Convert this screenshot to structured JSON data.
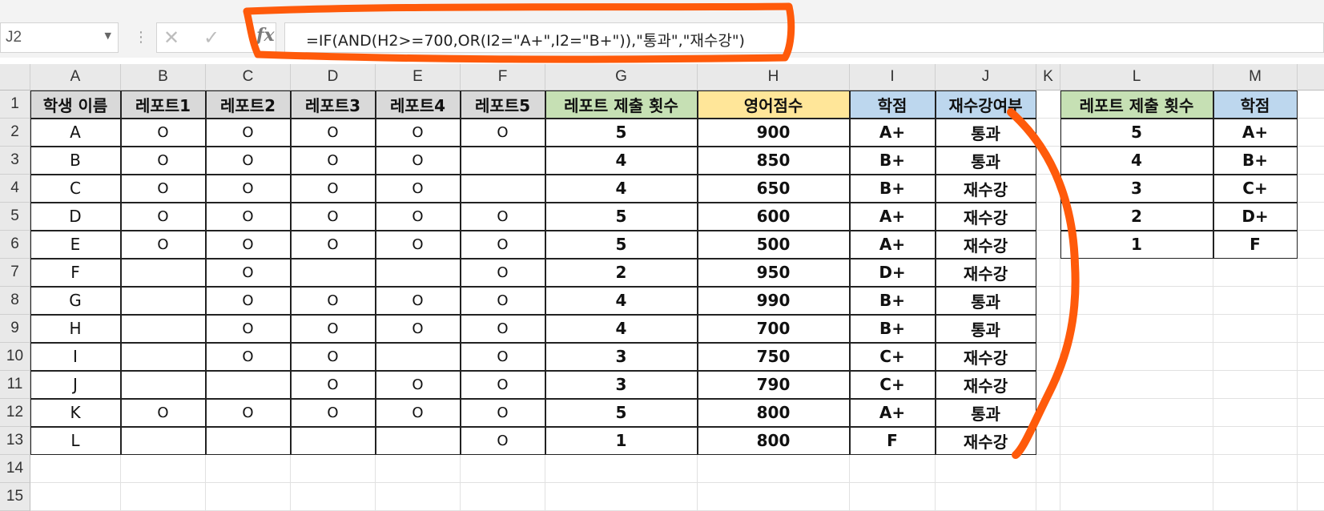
{
  "name_box": "J2",
  "formula": "=IF(AND(H2>=700,OR(I2=\"A+\",I2=\"B+\")),\"통과\",\"재수강\")",
  "colors": {
    "green_header": "#c6e0b4",
    "yellow_header": "#ffe699",
    "blue_header": "#bdd7ee",
    "gray_header": "#d9d9d9",
    "annotation": "#ff5a0a"
  },
  "columns": [
    "A",
    "B",
    "C",
    "D",
    "E",
    "F",
    "G",
    "H",
    "I",
    "J",
    "K",
    "L",
    "M"
  ],
  "rows": [
    "1",
    "2",
    "3",
    "4",
    "5",
    "6",
    "7",
    "8",
    "9",
    "10",
    "11",
    "12",
    "13",
    "14",
    "15"
  ],
  "table": {
    "headers": [
      "학생 이름",
      "레포트1",
      "레포트2",
      "레포트3",
      "레포트4",
      "레포트5",
      "레포트 제출 횟수",
      "영어점수",
      "학점",
      "재수강여부"
    ],
    "rows": [
      [
        "A",
        "O",
        "O",
        "O",
        "O",
        "O",
        "5",
        "900",
        "A+",
        "통과"
      ],
      [
        "B",
        "O",
        "O",
        "O",
        "O",
        "",
        "4",
        "850",
        "B+",
        "통과"
      ],
      [
        "C",
        "O",
        "O",
        "O",
        "O",
        "",
        "4",
        "650",
        "B+",
        "재수강"
      ],
      [
        "D",
        "O",
        "O",
        "O",
        "O",
        "O",
        "5",
        "600",
        "A+",
        "재수강"
      ],
      [
        "E",
        "O",
        "O",
        "O",
        "O",
        "O",
        "5",
        "500",
        "A+",
        "재수강"
      ],
      [
        "F",
        "",
        "O",
        "",
        "",
        "O",
        "2",
        "950",
        "D+",
        "재수강"
      ],
      [
        "G",
        "",
        "O",
        "O",
        "O",
        "O",
        "4",
        "990",
        "B+",
        "통과"
      ],
      [
        "H",
        "",
        "O",
        "O",
        "O",
        "O",
        "4",
        "700",
        "B+",
        "통과"
      ],
      [
        "I",
        "",
        "O",
        "O",
        "",
        "O",
        "3",
        "750",
        "C+",
        "재수강"
      ],
      [
        "J",
        "",
        "",
        "O",
        "O",
        "O",
        "3",
        "790",
        "C+",
        "재수강"
      ],
      [
        "K",
        "O",
        "O",
        "O",
        "O",
        "O",
        "5",
        "800",
        "A+",
        "통과"
      ],
      [
        "L",
        "",
        "",
        "",
        "",
        "O",
        "1",
        "800",
        "F",
        "재수강"
      ]
    ]
  },
  "lookup": {
    "headers": [
      "레포트 제출 횟수",
      "학점"
    ],
    "rows": [
      [
        "5",
        "A+"
      ],
      [
        "4",
        "B+"
      ],
      [
        "3",
        "C+"
      ],
      [
        "2",
        "D+"
      ],
      [
        "1",
        "F"
      ]
    ]
  }
}
